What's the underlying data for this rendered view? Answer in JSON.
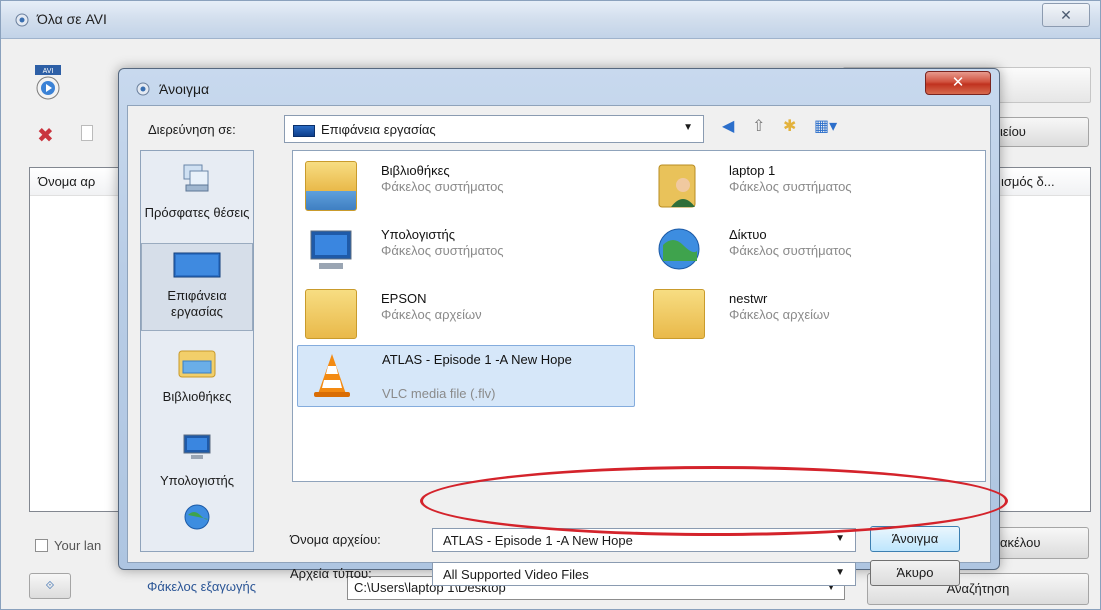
{
  "app": {
    "title": "Όλα σε AVI",
    "close_label": "✕",
    "avi_badge": "AVI",
    "btn_right_top": "ιείου",
    "column_left": "Όνομα αρ",
    "column_right": "ισμός δ...",
    "language_label": "Your lan",
    "btn_right_bottom": "ακέλου",
    "export_label": "Φάκελος εξαγωγής",
    "export_path": "C:\\Users\\laptop 1\\Desktop",
    "search_button": "Αναζήτηση"
  },
  "dialog": {
    "title": "Άνοιγμα",
    "close_label": "✕",
    "look_in_label": "Διερεύνηση σε:",
    "look_in_value": "Επιφάνεια εργασίας",
    "places": [
      {
        "label": "Πρόσφατες θέσεις",
        "icon": "recent-places-icon"
      },
      {
        "label": "Επιφάνεια εργασίας",
        "icon": "desktop-icon"
      },
      {
        "label": "Βιβλιοθήκες",
        "icon": "libraries-icon"
      },
      {
        "label": "Υπολογιστής",
        "icon": "computer-icon"
      },
      {
        "label": "",
        "icon": "network-icon"
      }
    ],
    "files": [
      {
        "name": "Βιβλιοθήκες",
        "type": "Φάκελος συστήματος",
        "icon": "libraries-folder-icon"
      },
      {
        "name": "laptop 1",
        "type": "Φάκελος συστήματος",
        "icon": "user-folder-icon"
      },
      {
        "name": "Υπολογιστής",
        "type": "Φάκελος συστήματος",
        "icon": "computer-icon"
      },
      {
        "name": "Δίκτυο",
        "type": "Φάκελος συστήματος",
        "icon": "network-icon"
      },
      {
        "name": "EPSON",
        "type": "Φάκελος αρχείων",
        "icon": "folder-icon"
      },
      {
        "name": "nestwr",
        "type": "Φάκελος αρχείων",
        "icon": "folder-icon"
      },
      {
        "name": "ATLAS - Episode 1 -A New Hope",
        "type": "VLC media file (.flv)",
        "icon": "vlc-cone-icon"
      }
    ],
    "filename_label": "Όνομα αρχείου:",
    "filename_value": "ATLAS - Episode 1 -A New Hope",
    "filetype_label": "Αρχεία τύπου:",
    "filetype_value": "All Supported Video Files",
    "open_button": "Άνοιγμα",
    "cancel_button": "Άκυρο"
  },
  "colors": {
    "annotation": "#d4232b",
    "dialog_frame": "#b9cde6",
    "selection": "#d6e7f9"
  }
}
